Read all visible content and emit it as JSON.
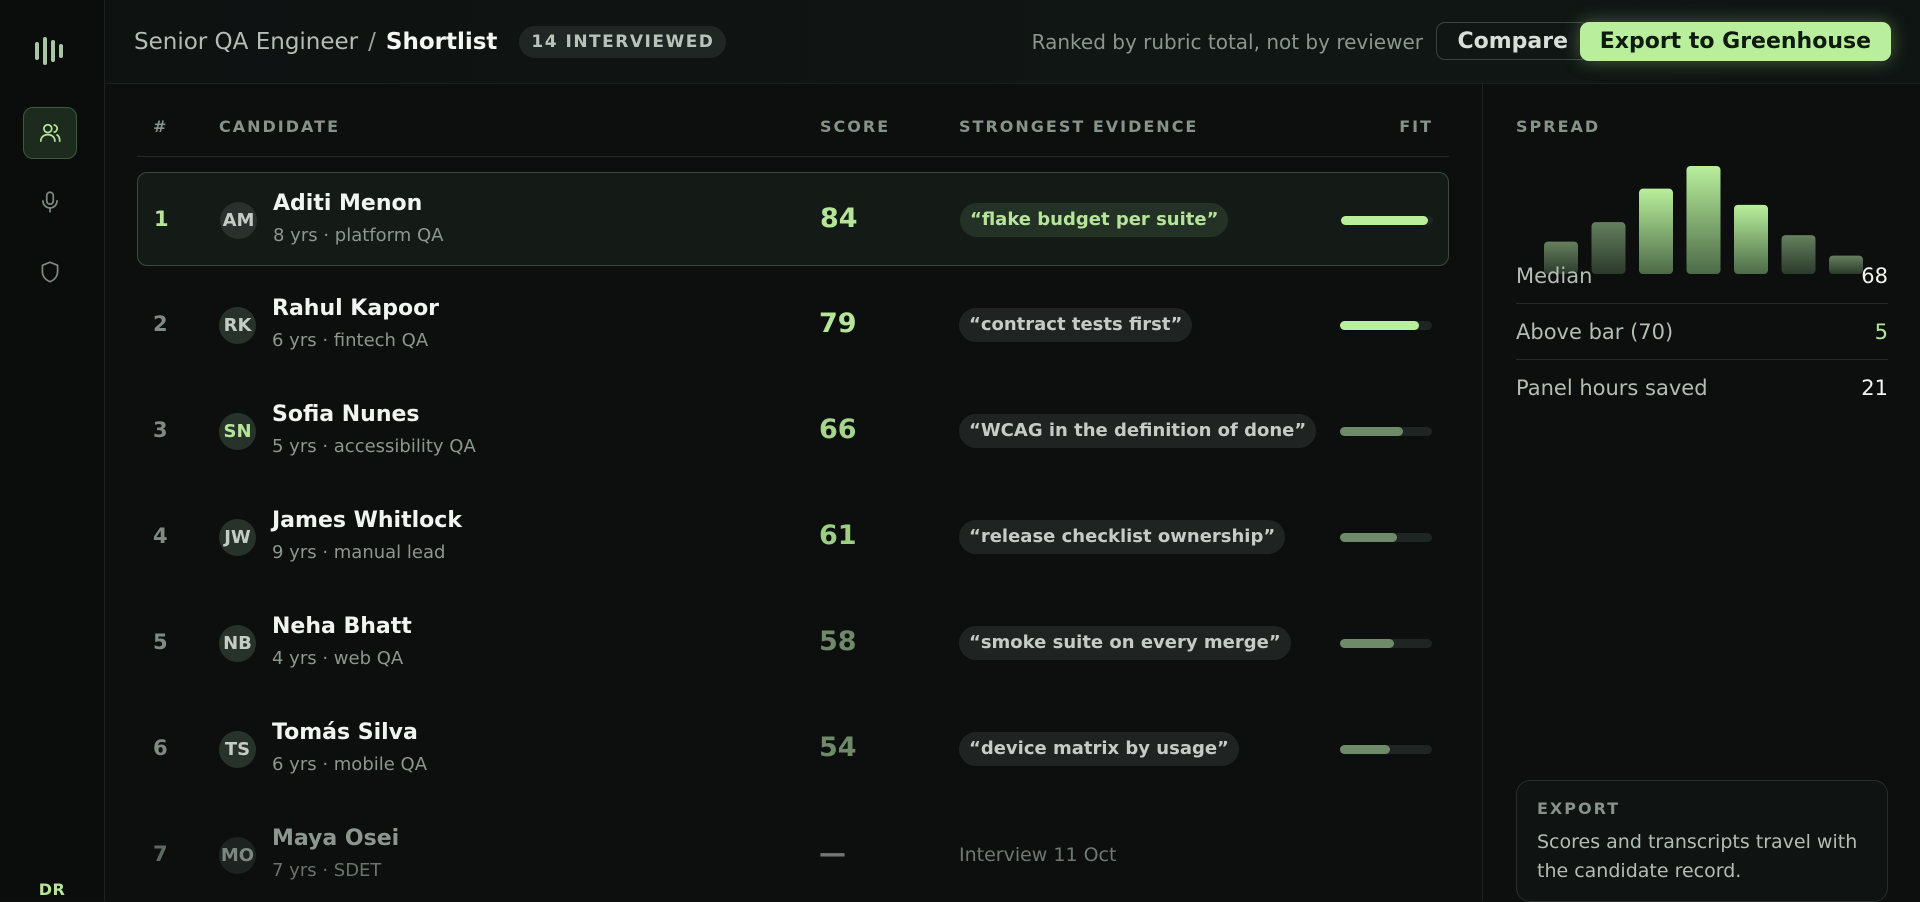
{
  "rail": {
    "nav": [
      "candidates-icon",
      "microphone-icon",
      "shield-icon"
    ],
    "user_initials": "DR"
  },
  "header": {
    "role": "Senior QA Engineer",
    "separator": "/",
    "page": "Shortlist",
    "badge": "14 INTERVIEWED",
    "note": "Ranked by rubric total, not by reviewer",
    "compare_label": "Compare",
    "export_label": "Export to Greenhouse"
  },
  "table": {
    "columns": {
      "rank": "#",
      "candidate": "CANDIDATE",
      "score": "SCORE",
      "evidence": "STRONGEST EVIDENCE",
      "fit": "FIT"
    },
    "rows": [
      {
        "rank": "1",
        "initials": "AM",
        "name": "Aditi Menon",
        "meta": "8 yrs · platform QA",
        "score": "84",
        "evidence": "“flake budget per suite”",
        "fit": 0.95,
        "selected": true
      },
      {
        "rank": "2",
        "initials": "RK",
        "name": "Rahul Kapoor",
        "meta": "6 yrs · fintech QA",
        "score": "79",
        "evidence": "“contract tests first”",
        "fit": 0.86
      },
      {
        "rank": "3",
        "initials": "SN",
        "name": "Sofia Nunes",
        "meta": "5 yrs · accessibility QA",
        "score": "66",
        "evidence": "“WCAG in the definition of done”",
        "fit": 0.69
      },
      {
        "rank": "4",
        "initials": "JW",
        "name": "James Whitlock",
        "meta": "9 yrs · manual lead",
        "score": "61",
        "evidence": "“release checklist ownership”",
        "fit": 0.62
      },
      {
        "rank": "5",
        "initials": "NB",
        "name": "Neha Bhatt",
        "meta": "4 yrs · web QA",
        "score": "58",
        "evidence": "“smoke suite on every merge”",
        "fit": 0.59
      },
      {
        "rank": "6",
        "initials": "TS",
        "name": "Tomás Silva",
        "meta": "6 yrs · mobile QA",
        "score": "54",
        "evidence": "“device matrix by usage”",
        "fit": 0.54
      },
      {
        "rank": "7",
        "initials": "MO",
        "name": "Maya Osei",
        "meta": "7 yrs · SDET",
        "score": "—",
        "evidence": "Interview 11 Oct",
        "fit": null,
        "pending": true
      }
    ]
  },
  "side": {
    "spread_label": "SPREAD",
    "spread_bars": [
      0.3,
      0.48,
      0.79,
      1.0,
      0.64,
      0.36,
      0.17
    ],
    "stats": [
      {
        "label": "Median",
        "value": "68"
      },
      {
        "label": "Above bar (70)",
        "value": "5"
      },
      {
        "label": "Panel hours saved",
        "value": "21"
      }
    ],
    "export": {
      "title": "EXPORT",
      "desc": "Scores and transcripts travel with the candidate record."
    }
  },
  "colors": {
    "accent": "#b9ef9c",
    "accent_dim": "#6f8a69",
    "bg": "#0c0f0e"
  }
}
